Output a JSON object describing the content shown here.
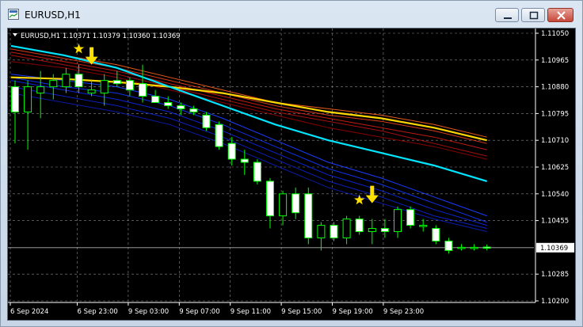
{
  "window": {
    "title": "EURUSD,H1"
  },
  "header": {
    "text": "EURUSD,H1  1.10371 1.10379 1.10360 1.10369"
  },
  "price_axis": {
    "labels": [
      "1.11050",
      "1.10965",
      "1.10880",
      "1.10795",
      "1.10710",
      "1.10625",
      "1.10540",
      "1.10455",
      "1.10285",
      "1.10200"
    ],
    "current_price": "1.10369"
  },
  "time_axis": {
    "labels": [
      "6 Sep 2024",
      "6 Sep 23:00",
      "9 Sep 03:00",
      "9 Sep 07:00",
      "9 Sep 11:00",
      "9 Sep 15:00",
      "9 Sep 19:00",
      "9 Sep 23:00"
    ]
  },
  "colors": {
    "background": "#000000",
    "grid": "#8a8a8a",
    "candle_bull": "#000000",
    "candle_bear": "#ffffff",
    "candle_outline": "#00ff00",
    "ema_fast": "#0000ff",
    "ema_slow": "#ff0000",
    "yellow_line": "#ffd700",
    "cyan_line": "#00e5ff",
    "marker": "#ffe100"
  },
  "chart_data": {
    "type": "candlestick",
    "symbol": "EURUSD",
    "timeframe": "H1",
    "ylim": [
      1.102,
      1.1105
    ],
    "last_price": 1.10369,
    "candles": [
      {
        "o": 1.1088,
        "h": 1.109,
        "l": 1.107,
        "c": 1.108
      },
      {
        "o": 1.108,
        "h": 1.109,
        "l": 1.1068,
        "c": 1.1088
      },
      {
        "o": 1.1086,
        "h": 1.1093,
        "l": 1.1078,
        "c": 1.1088
      },
      {
        "o": 1.1088,
        "h": 1.1092,
        "l": 1.1084,
        "c": 1.109
      },
      {
        "o": 1.1088,
        "h": 1.1094,
        "l": 1.1086,
        "c": 1.1092
      },
      {
        "o": 1.1092,
        "h": 1.1095,
        "l": 1.1086,
        "c": 1.1088
      },
      {
        "o": 1.1086,
        "h": 1.109,
        "l": 1.1085,
        "c": 1.1087
      },
      {
        "o": 1.1086,
        "h": 1.1092,
        "l": 1.1082,
        "c": 1.109
      },
      {
        "o": 1.109,
        "h": 1.1093,
        "l": 1.1088,
        "c": 1.1089
      },
      {
        "o": 1.109,
        "h": 1.1091,
        "l": 1.1085,
        "c": 1.1087
      },
      {
        "o": 1.1089,
        "h": 1.1095,
        "l": 1.1083,
        "c": 1.1085
      },
      {
        "o": 1.1085,
        "h": 1.1087,
        "l": 1.1083,
        "c": 1.1083
      },
      {
        "o": 1.1083,
        "h": 1.1085,
        "l": 1.1081,
        "c": 1.1082
      },
      {
        "o": 1.1082,
        "h": 1.1083,
        "l": 1.1079,
        "c": 1.1081
      },
      {
        "o": 1.1081,
        "h": 1.1082,
        "l": 1.1079,
        "c": 1.108
      },
      {
        "o": 1.1079,
        "h": 1.108,
        "l": 1.1074,
        "c": 1.1075
      },
      {
        "o": 1.1076,
        "h": 1.1077,
        "l": 1.1068,
        "c": 1.1069
      },
      {
        "o": 1.107,
        "h": 1.1072,
        "l": 1.1063,
        "c": 1.1065
      },
      {
        "o": 1.1065,
        "h": 1.1068,
        "l": 1.106,
        "c": 1.1064
      },
      {
        "o": 1.1064,
        "h": 1.1065,
        "l": 1.1057,
        "c": 1.1058
      },
      {
        "o": 1.1058,
        "h": 1.1059,
        "l": 1.1043,
        "c": 1.1047
      },
      {
        "o": 1.1047,
        "h": 1.1055,
        "l": 1.1044,
        "c": 1.1054
      },
      {
        "o": 1.1054,
        "h": 1.1056,
        "l": 1.1046,
        "c": 1.1048
      },
      {
        "o": 1.1054,
        "h": 1.1056,
        "l": 1.1038,
        "c": 1.104
      },
      {
        "o": 1.104,
        "h": 1.1045,
        "l": 1.1036,
        "c": 1.1044
      },
      {
        "o": 1.1044,
        "h": 1.1045,
        "l": 1.1039,
        "c": 1.104
      },
      {
        "o": 1.104,
        "h": 1.1047,
        "l": 1.1038,
        "c": 1.1046
      },
      {
        "o": 1.1046,
        "h": 1.1047,
        "l": 1.1041,
        "c": 1.1042
      },
      {
        "o": 1.1042,
        "h": 1.1046,
        "l": 1.1038,
        "c": 1.1043
      },
      {
        "o": 1.1043,
        "h": 1.1046,
        "l": 1.104,
        "c": 1.1042
      },
      {
        "o": 1.1042,
        "h": 1.105,
        "l": 1.104,
        "c": 1.1049
      },
      {
        "o": 1.1049,
        "h": 1.105,
        "l": 1.1043,
        "c": 1.1044
      },
      {
        "o": 1.1044,
        "h": 1.1046,
        "l": 1.1042,
        "c": 1.1044
      },
      {
        "o": 1.1043,
        "h": 1.1044,
        "l": 1.1038,
        "c": 1.1039
      },
      {
        "o": 1.1039,
        "h": 1.104,
        "l": 1.1035,
        "c": 1.1036
      },
      {
        "o": 1.1037,
        "h": 1.1038,
        "l": 1.1036,
        "c": 1.1037
      },
      {
        "o": 1.1037,
        "h": 1.1038,
        "l": 1.1036,
        "c": 1.1037
      },
      {
        "o": 1.10371,
        "h": 1.10379,
        "l": 1.1036,
        "c": 1.10369
      }
    ],
    "moving_averages": {
      "fast_blue": [
        [
          1.1086,
          1.1083,
          1.108,
          1.1076,
          1.107,
          1.1063,
          1.1056,
          1.1051,
          1.1046,
          1.1042
        ],
        [
          1.1088,
          1.1085,
          1.1082,
          1.1078,
          1.1072,
          1.1065,
          1.1058,
          1.1053,
          1.1047,
          1.1043
        ],
        [
          1.109,
          1.1087,
          1.1084,
          1.108,
          1.1074,
          1.1067,
          1.106,
          1.1055,
          1.1049,
          1.1044
        ],
        [
          1.1091,
          1.1088,
          1.1086,
          1.1082,
          1.1076,
          1.1069,
          1.1062,
          1.1057,
          1.1051,
          1.1045
        ],
        [
          1.1092,
          1.109,
          1.1088,
          1.1084,
          1.1078,
          1.1071,
          1.1064,
          1.1059,
          1.1053,
          1.1047
        ]
      ],
      "slow_red": [
        [
          1.1096,
          1.1094,
          1.1091,
          1.1087,
          1.1083,
          1.1079,
          1.1075,
          1.1072,
          1.1069,
          1.1065
        ],
        [
          1.1098,
          1.1095,
          1.1092,
          1.1088,
          1.1084,
          1.108,
          1.1077,
          1.1074,
          1.107,
          1.1066
        ],
        [
          1.1099,
          1.1096,
          1.1093,
          1.1089,
          1.1085,
          1.1081,
          1.1078,
          1.1075,
          1.1072,
          1.1068
        ],
        [
          1.11,
          1.1097,
          1.1094,
          1.109,
          1.1086,
          1.1082,
          1.1079,
          1.1077,
          1.1074,
          1.107
        ],
        [
          1.1101,
          1.1098,
          1.1095,
          1.1091,
          1.1087,
          1.1083,
          1.1081,
          1.1079,
          1.1076,
          1.1072
        ]
      ],
      "yellow": [
        1.1091,
        1.10905,
        1.10895,
        1.1088,
        1.1086,
        1.1083,
        1.108,
        1.1078,
        1.1075,
        1.1071
      ],
      "cyan": [
        1.1101,
        1.1098,
        1.1094,
        1.1088,
        1.1082,
        1.1076,
        1.1071,
        1.1067,
        1.1063,
        1.1058
      ]
    },
    "markers": [
      {
        "type": "arrow-down",
        "candle": 6
      },
      {
        "type": "star",
        "candle": 5
      },
      {
        "type": "arrow-down",
        "candle": 28
      },
      {
        "type": "star",
        "candle": 27
      }
    ]
  }
}
